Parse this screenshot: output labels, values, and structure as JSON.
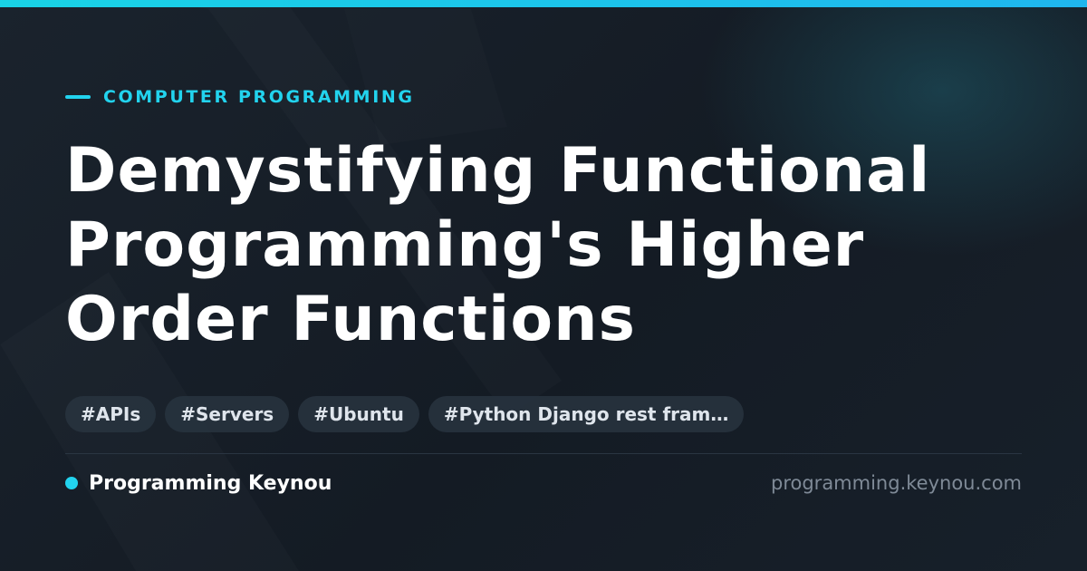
{
  "category": "COMPUTER PROGRAMMING",
  "title": "Demystifying Functional Programming's Higher Order Functions",
  "tags": [
    "#APIs",
    "#Servers",
    "#Ubuntu",
    "#Python Django rest fram…"
  ],
  "brand": {
    "name": "Programming Keynou",
    "url": "programming.keynou.com"
  },
  "colors": {
    "accent": "#22d3ee",
    "background": "#151c25",
    "text": "#ffffff",
    "muted": "#7f8a97"
  }
}
